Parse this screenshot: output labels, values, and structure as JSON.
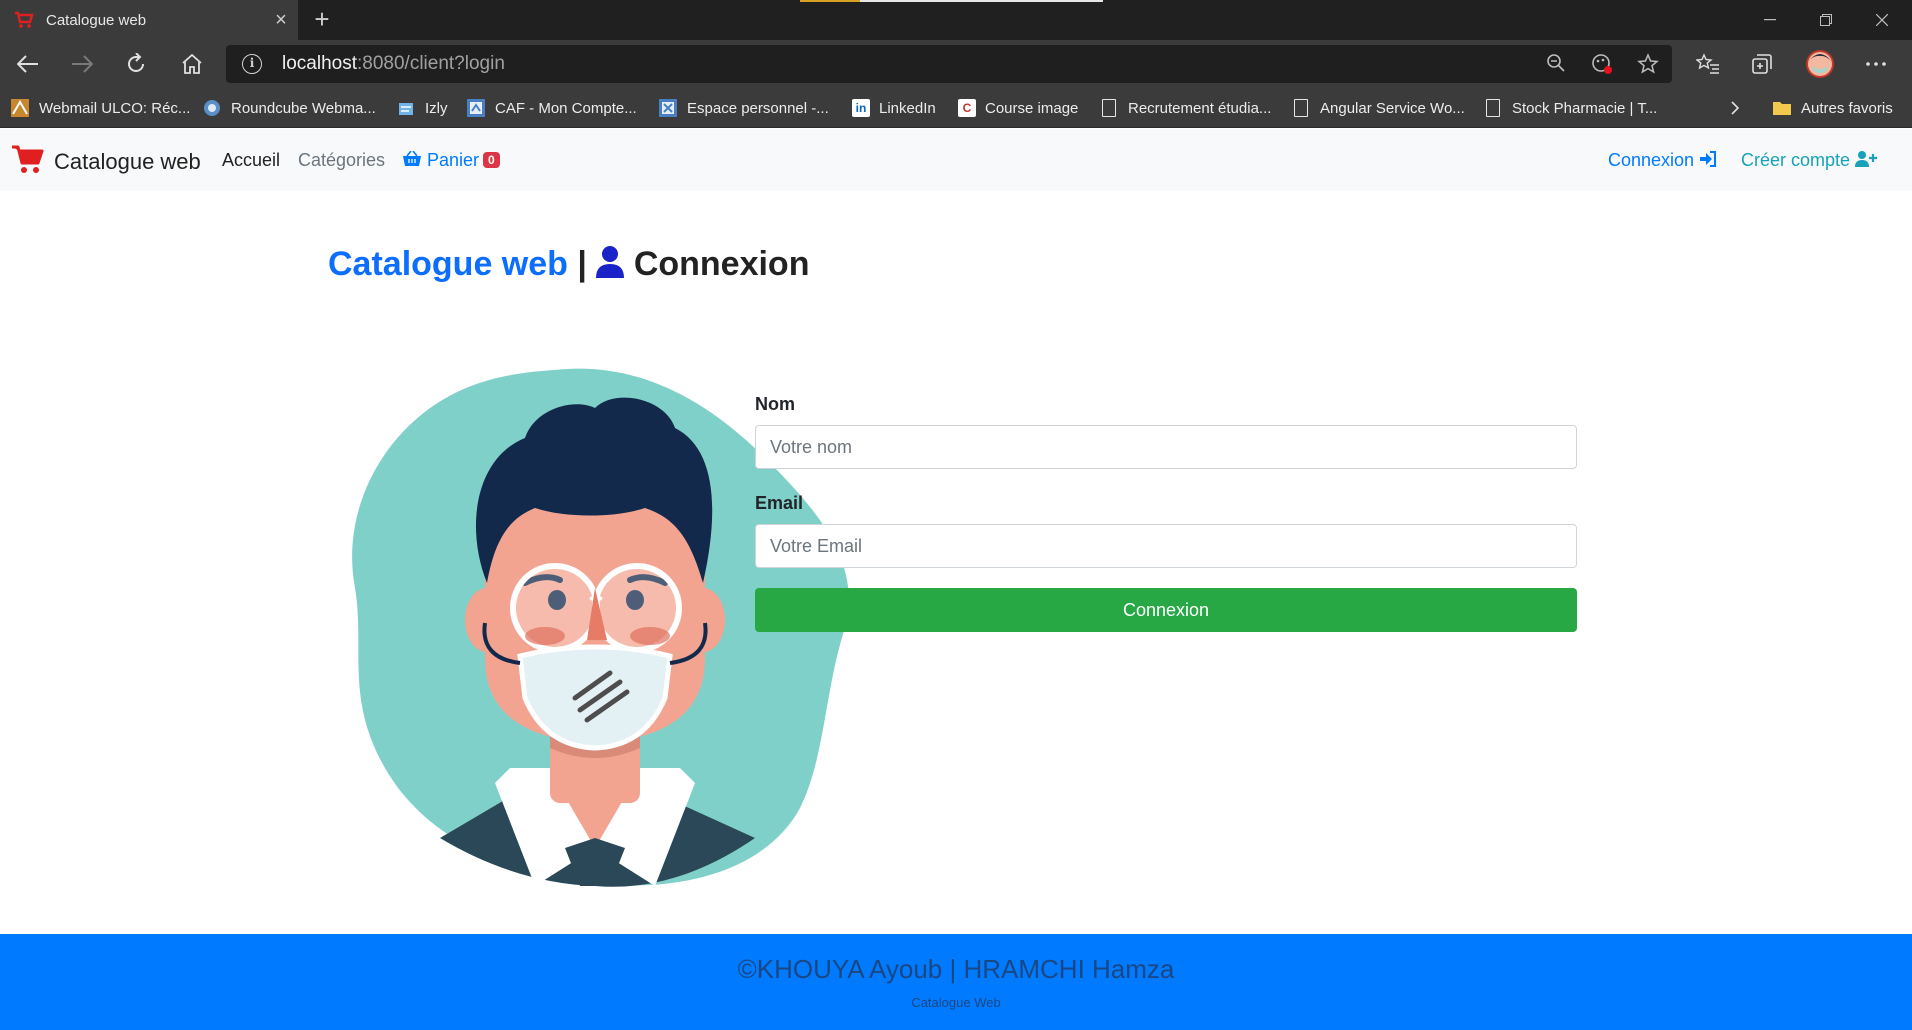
{
  "browser": {
    "tab_title": "Catalogue web",
    "new_tab": "+",
    "url_host": "localhost",
    "url_rest": ":8080/client?login",
    "bookmarks": [
      {
        "label": "Webmail ULCO: Réc...",
        "icon": "webmail-icon"
      },
      {
        "label": "Roundcube Webma...",
        "icon": "roundcube-icon"
      },
      {
        "label": "Izly",
        "icon": "izly-icon"
      },
      {
        "label": "CAF - Mon Compte...",
        "icon": "caf-icon"
      },
      {
        "label": "Espace personnel -...",
        "icon": "espace-icon"
      },
      {
        "label": "LinkedIn",
        "icon": "linkedin-icon"
      },
      {
        "label": "Course image",
        "icon": "course-icon"
      },
      {
        "label": "Recrutement étudia...",
        "icon": "page-icon"
      },
      {
        "label": "Angular Service Wo...",
        "icon": "page-icon"
      },
      {
        "label": "Stock Pharmacie | T...",
        "icon": "page-icon"
      }
    ],
    "other_favorites": "Autres favoris",
    "linkedin_glyph": "in",
    "course_glyph": "C"
  },
  "navbar": {
    "brand": "Catalogue web",
    "links": {
      "home": "Accueil",
      "categories": "Catégories",
      "cart": "Panier",
      "cart_count": "0",
      "login": "Connexion",
      "signup": "Créer compte"
    }
  },
  "heading": {
    "site": "Catalogue web",
    "separator": "|",
    "page": "Connexion"
  },
  "form": {
    "name_label": "Nom",
    "name_placeholder": "Votre nom",
    "email_label": "Email",
    "email_placeholder": "Votre Email",
    "submit": "Connexion"
  },
  "footer": {
    "authors": "©KHOUYA Ayoub | HRAMCHI Hamza",
    "subtitle": "Catalogue Web"
  },
  "colors": {
    "primary": "#007bff",
    "success": "#28a745",
    "danger": "#dc3545",
    "illustration_bg": "#80d0ca"
  }
}
